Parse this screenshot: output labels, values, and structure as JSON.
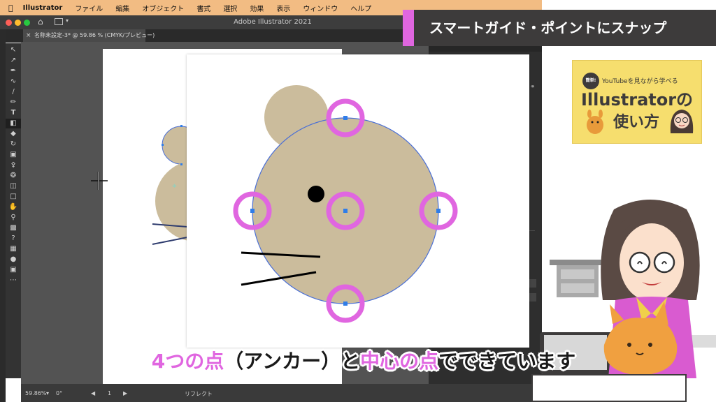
{
  "menubar": {
    "apple_icon": "apple-icon",
    "app_name": "Illustrator",
    "items": [
      "ファイル",
      "編集",
      "オブジェクト",
      "書式",
      "選択",
      "効果",
      "表示",
      "ウィンドウ",
      "ヘルプ"
    ]
  },
  "window": {
    "title": "Adobe Illustrator 2021",
    "document_tab": "名称未設定-3* @ 59.86 % (CMYK/プレビュー)"
  },
  "status": {
    "zoom": "59.86%",
    "rotation": "0°",
    "artboard": "1",
    "tool_name": "リフレクト"
  },
  "banner": {
    "title": "スマートガイド・ポイントにスナップ"
  },
  "logo": {
    "badge": "簡単!",
    "tagline": "YouTubeを見ながら学べる",
    "title_line1": "Illustratorの",
    "title_line2": "使い方"
  },
  "caption": {
    "part1": "4つの点",
    "part2": "（アンカー）と",
    "part3": "中心の点",
    "part4": "でできています"
  },
  "colors": {
    "accent": "#e066e0",
    "mouse_fill": "#cbbc9c",
    "anchor": "#2f7de8",
    "path_outline": "#4a6fd6",
    "menubar": "#f2bc83",
    "banner_bg": "#3d3b3b"
  }
}
